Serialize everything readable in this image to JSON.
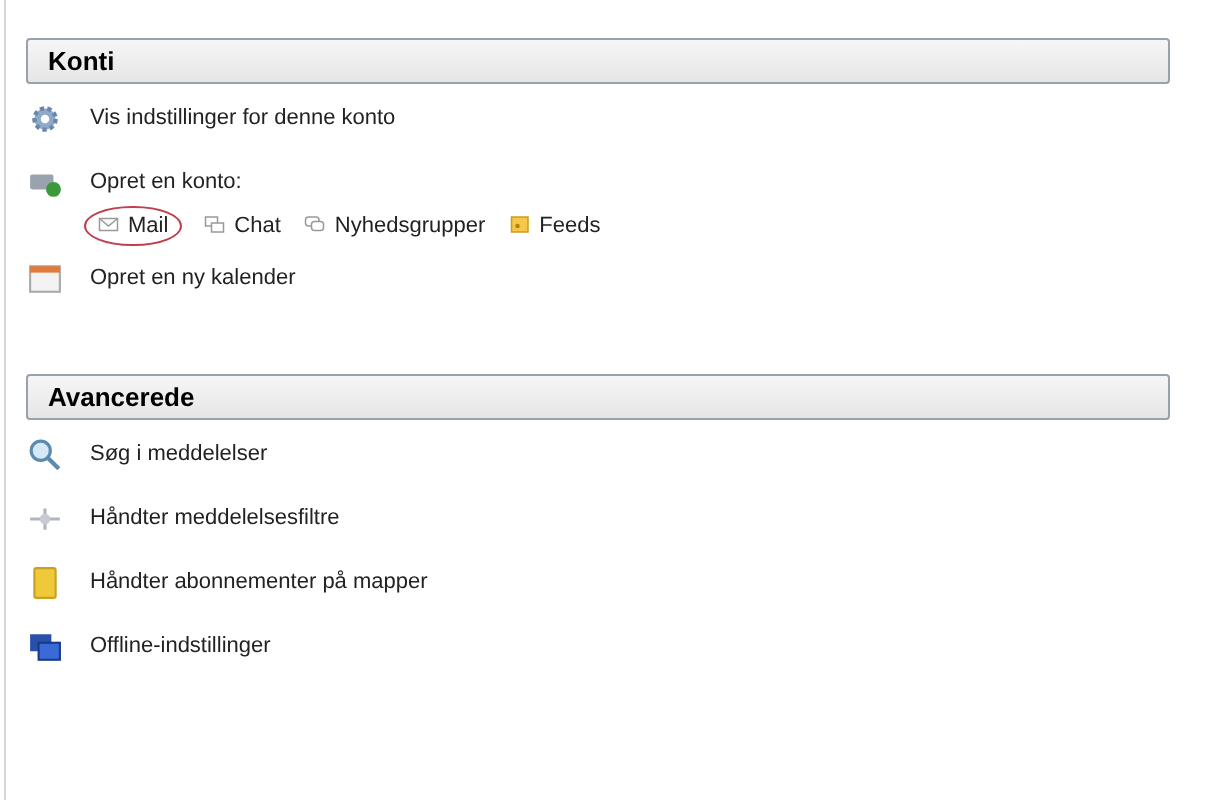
{
  "sections": [
    {
      "title": "Konti",
      "items": [
        {
          "label": "Vis indstillinger for denne konto"
        },
        {
          "label": "Opret en konto:",
          "links": [
            {
              "label": "Mail",
              "circled": true
            },
            {
              "label": "Chat",
              "circled": false
            },
            {
              "label": "Nyhedsgrupper",
              "circled": false
            },
            {
              "label": "Feeds",
              "circled": false
            }
          ]
        },
        {
          "label": "Opret en ny kalender"
        }
      ]
    },
    {
      "title": "Avancerede",
      "items": [
        {
          "label": "Søg i meddelelser"
        },
        {
          "label": "Håndter meddelelsesfiltre"
        },
        {
          "label": "Håndter abonnementer på mapper"
        },
        {
          "label": "Offline-indstillinger"
        }
      ]
    }
  ]
}
